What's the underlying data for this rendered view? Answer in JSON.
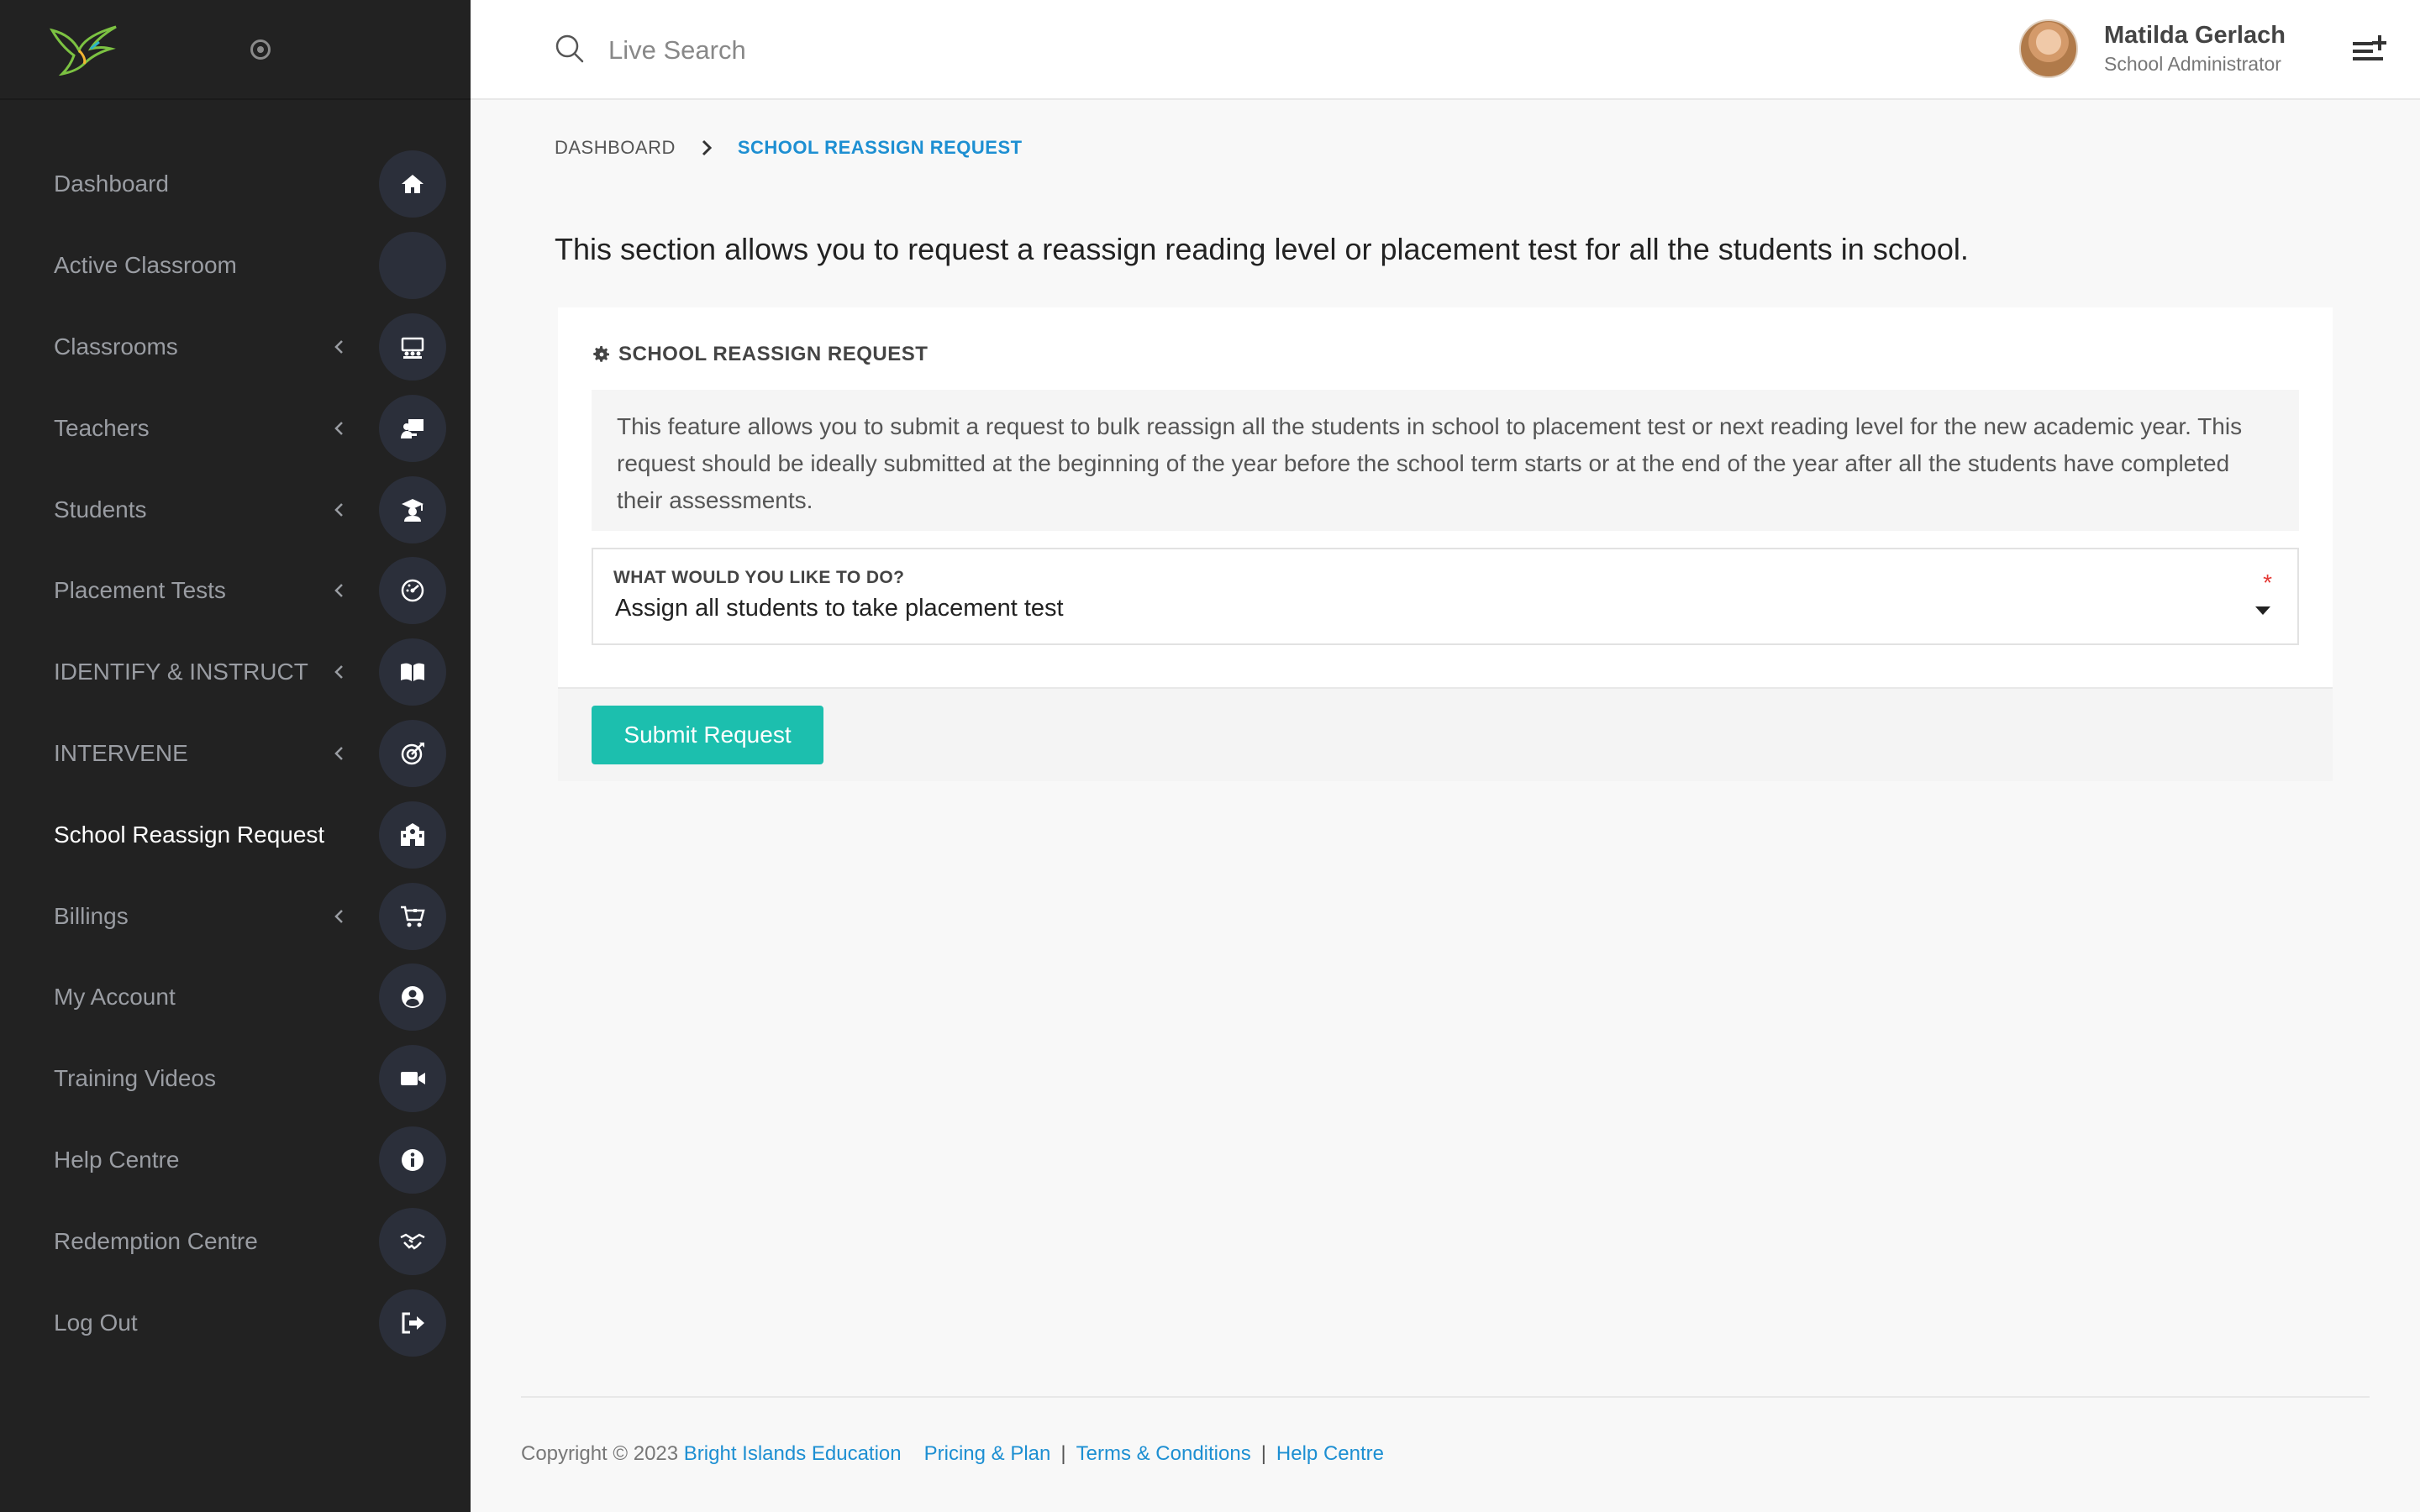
{
  "colors": {
    "sidebar_bg": "#222222",
    "sidebar_icon_bg": "#2b2f3a",
    "accent_link": "#1d8fd2",
    "button": "#1cbfae",
    "required": "#e53935"
  },
  "sidebar": {
    "logo_icon": "hummingbird-logo",
    "pin_icon": "radio-dot-icon",
    "items": [
      {
        "label": "Dashboard",
        "icon": "home-icon",
        "submenu": false,
        "active": false
      },
      {
        "label": "Active Classroom",
        "icon": "",
        "submenu": false,
        "active": false
      },
      {
        "label": "Classrooms",
        "icon": "classroom-icon",
        "submenu": true,
        "active": false
      },
      {
        "label": "Teachers",
        "icon": "teacher-icon",
        "submenu": true,
        "active": false
      },
      {
        "label": "Students",
        "icon": "graduate-icon",
        "submenu": true,
        "active": false
      },
      {
        "label": "Placement Tests",
        "icon": "gauge-icon",
        "submenu": true,
        "active": false
      },
      {
        "label": "IDENTIFY & INSTRUCT",
        "icon": "book-icon",
        "submenu": true,
        "active": false
      },
      {
        "label": "INTERVENE",
        "icon": "target-icon",
        "submenu": true,
        "active": false
      },
      {
        "label": "School Reassign Request",
        "icon": "school-icon",
        "submenu": false,
        "active": true
      },
      {
        "label": "Billings",
        "icon": "cart-icon",
        "submenu": true,
        "active": false
      },
      {
        "label": "My Account",
        "icon": "user-circle-icon",
        "submenu": false,
        "active": false
      },
      {
        "label": "Training Videos",
        "icon": "video-icon",
        "submenu": false,
        "active": false
      },
      {
        "label": "Help Centre",
        "icon": "info-icon",
        "submenu": false,
        "active": false
      },
      {
        "label": "Redemption Centre",
        "icon": "handshake-icon",
        "submenu": false,
        "active": false
      },
      {
        "label": "Log Out",
        "icon": "logout-icon",
        "submenu": false,
        "active": false
      }
    ]
  },
  "header": {
    "search_placeholder": "Live Search",
    "user_name": "Matilda Gerlach",
    "user_role": "School Administrator",
    "menu_icon": "playlist-add-icon"
  },
  "breadcrumb": {
    "home": "DASHBOARD",
    "current": "SCHOOL REASSIGN REQUEST"
  },
  "main": {
    "intro": "This section allows you to request a reassign reading level or placement test for all the students in school.",
    "card_title": "SCHOOL REASSIGN REQUEST",
    "note": "This feature allows you to submit a request to bulk reassign all the students in school to placement test or next reading level for the new academic year. This request should be ideally submitted at the beginning of the year before the school term starts or at the end of the year after all the students have completed their assessments.",
    "field_label": "WHAT WOULD YOU LIKE TO DO?",
    "field_value": "Assign all students to take placement test",
    "required_mark": "*",
    "submit_label": "Submit Request"
  },
  "footer": {
    "copyright": "Copyright © 2023",
    "company": "Bright Islands Education",
    "links": [
      "Pricing & Plan",
      "Terms & Conditions",
      "Help Centre"
    ],
    "separator": "|"
  }
}
